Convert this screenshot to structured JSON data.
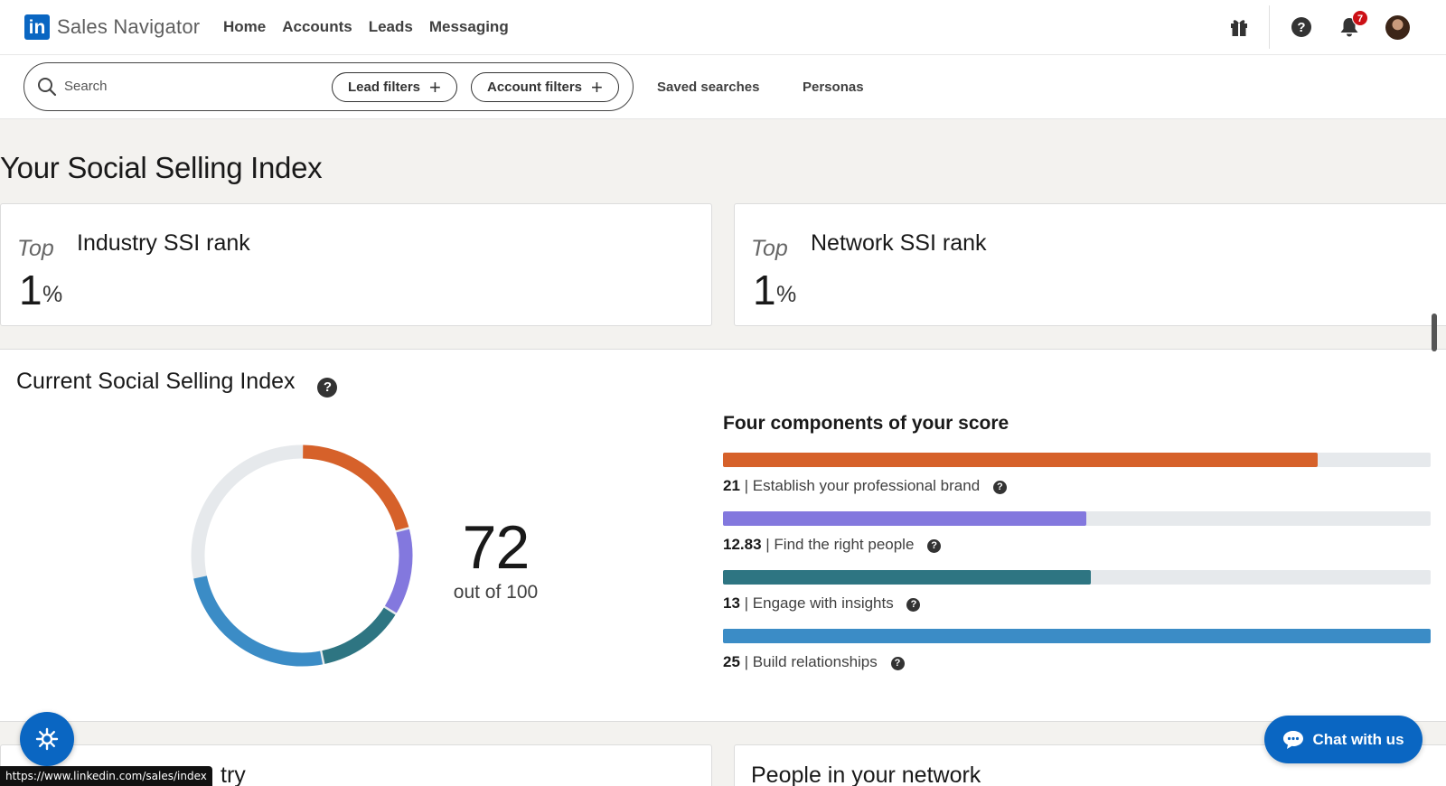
{
  "nav": {
    "logo_mark": "in",
    "logo_text": "Sales Navigator",
    "links": [
      "Home",
      "Accounts",
      "Leads",
      "Messaging"
    ],
    "notification_count": "7",
    "icons": [
      "gift-icon",
      "help-icon",
      "bell-icon",
      "avatar"
    ]
  },
  "search": {
    "placeholder": "Search",
    "lead_filters_label": "Lead filters",
    "account_filters_label": "Account filters",
    "plus": "+",
    "saved_searches_label": "Saved searches",
    "personas_label": "Personas"
  },
  "page": {
    "title": "Your Social Selling Index"
  },
  "ranks": {
    "industry": {
      "prefix": "Top",
      "title": "Industry SSI rank",
      "value": "1",
      "unit": "%"
    },
    "network": {
      "prefix": "Top",
      "title": "Network SSI rank",
      "value": "1",
      "unit": "%"
    }
  },
  "ssi": {
    "title": "Current Social Selling Index",
    "help_glyph": "?",
    "score": "72",
    "score_sub": "out of 100",
    "max_total": 100,
    "components_title": "Four components of your score",
    "component_max": 25,
    "components": [
      {
        "value": 21,
        "value_text": "21",
        "label": "Establish your professional brand",
        "color": "#d6612a"
      },
      {
        "value": 12.83,
        "value_text": "12.83",
        "label": "Find the right people",
        "color": "#8378de"
      },
      {
        "value": 13,
        "value_text": "13",
        "label": "Engage with insights",
        "color": "#2e7582"
      },
      {
        "value": 25,
        "value_text": "25",
        "label": "Build relationships",
        "color": "#3b8cc6"
      }
    ],
    "track_color": "#e6e9ec"
  },
  "bottom": {
    "left_title_visible": "try",
    "right_title": "People in your network"
  },
  "chat": {
    "label": "Chat with us"
  },
  "status_url": "https://www.linkedin.com/sales/index",
  "colors": {
    "brand": "#0a66c2",
    "badge": "#cc1016"
  }
}
